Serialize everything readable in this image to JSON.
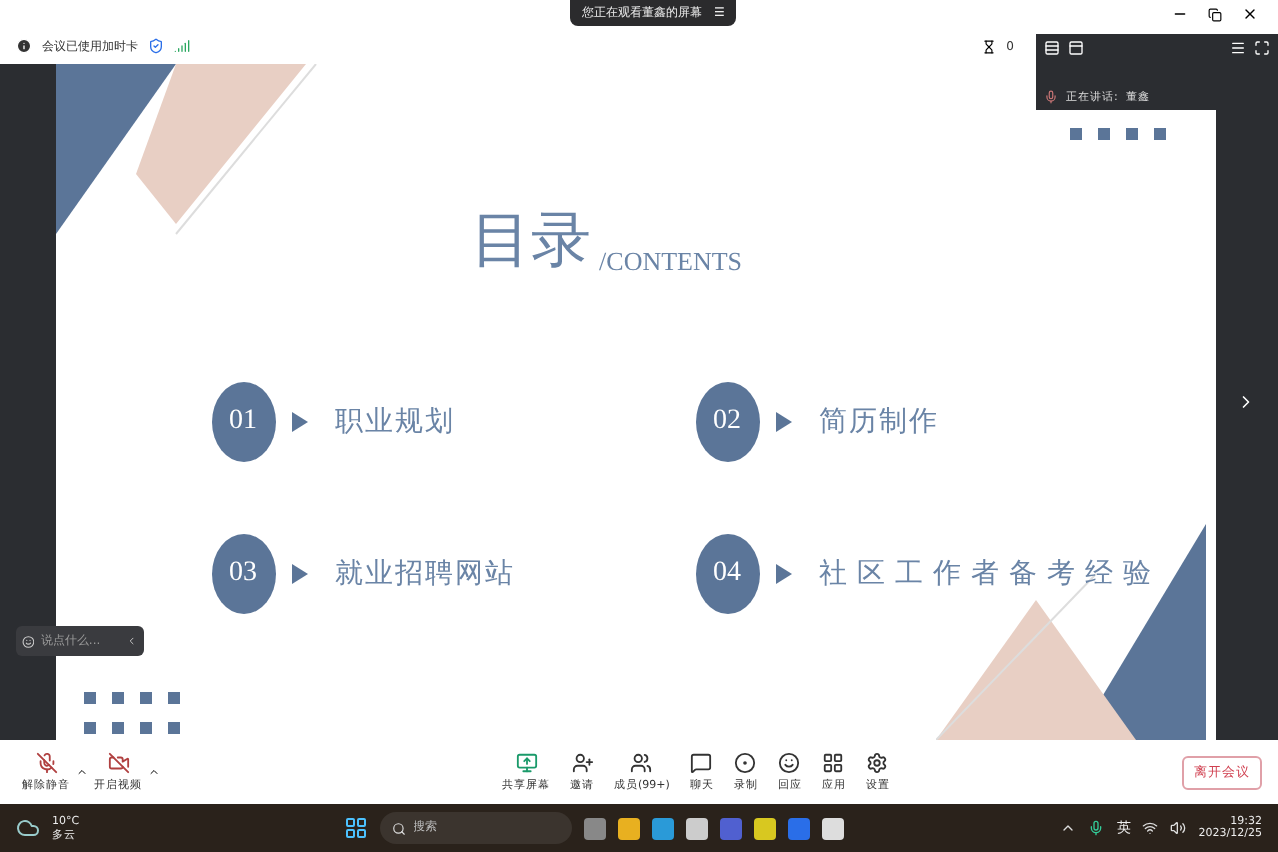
{
  "window": {
    "banner": "您正在观看董鑫的屏幕",
    "banner_icon": "☰"
  },
  "info_bar": {
    "status": "会议已使用加时卡",
    "timer": "0"
  },
  "speaker_panel": {
    "label": "正在讲话:",
    "name": "董鑫"
  },
  "slide": {
    "title": "目录",
    "subtitle": "/CONTENTS",
    "items": [
      {
        "number": "01",
        "label": "职业规划"
      },
      {
        "number": "02",
        "label": "简历制作"
      },
      {
        "number": "03",
        "label": "就业招聘网站"
      },
      {
        "number": "04",
        "label": "社区工作者备考经验"
      }
    ]
  },
  "chat": {
    "placeholder": "说点什么..."
  },
  "toolbar": {
    "left": [
      {
        "kind": "mic",
        "label": "解除静音"
      },
      {
        "kind": "video",
        "label": "开启视频"
      }
    ],
    "center": [
      {
        "kind": "share",
        "label": "共享屏幕"
      },
      {
        "kind": "invite",
        "label": "邀请"
      },
      {
        "kind": "members",
        "label": "成员(99+)"
      },
      {
        "kind": "chat",
        "label": "聊天"
      },
      {
        "kind": "record",
        "label": "录制"
      },
      {
        "kind": "react",
        "label": "回应"
      },
      {
        "kind": "apps",
        "label": "应用"
      },
      {
        "kind": "settings",
        "label": "设置"
      }
    ],
    "leave": "离开会议"
  },
  "taskbar": {
    "temperature": "10°C",
    "weather": "多云",
    "search_placeholder": "搜索",
    "ime": "英",
    "time": "19:32",
    "date": "2023/12/25"
  }
}
